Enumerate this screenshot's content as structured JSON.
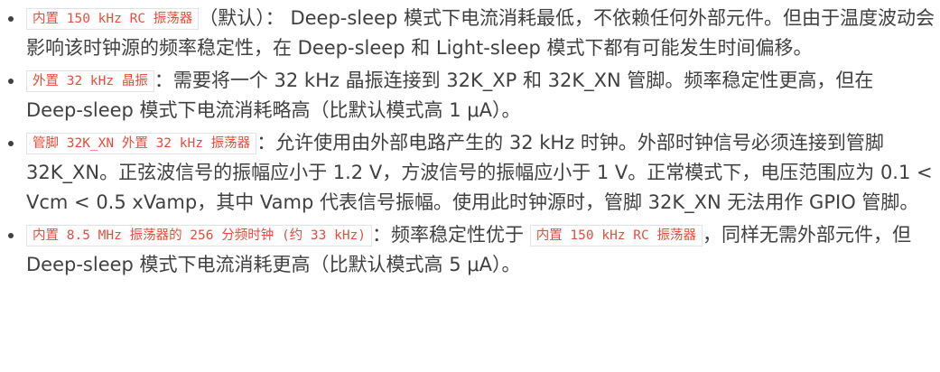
{
  "items": [
    {
      "code": "内置 150 kHz RC 振荡器",
      "text": "（默认）： Deep-sleep 模式下电流消耗最低，不依赖任何外部元件。但由于温度波动会影响该时钟源的频率稳定性，在 Deep-sleep 和 Light-sleep 模式下都有可能发生时间偏移。"
    },
    {
      "code": "外置 32 kHz 晶振",
      "text": "：需要将一个 32 kHz 晶振连接到 32K_XP 和 32K_XN 管脚。频率稳定性更高，但在 Deep-sleep 模式下电流消耗略高（比默认模式高 1 μA）。"
    },
    {
      "code": "管脚 32K_XN 外置 32 kHz 振荡器",
      "text": "：允许使用由外部电路产生的 32 kHz 时钟。外部时钟信号必须连接到管脚 32K_XN。正弦波信号的振幅应小于 1.2 V，方波信号的振幅应小于 1 V。正常模式下，电压范围应为 0.1 < Vcm < 0.5 xVamp，其中 Vamp 代表信号振幅。使用此时钟源时，管脚 32K_XN 无法用作 GPIO 管脚。"
    },
    {
      "code": "内置 8.5 MHz 振荡器的 256 分频时钟 (约 33 kHz)",
      "text_a": "：频率稳定性优于",
      "code2": "内置 150 kHz RC 振荡器",
      "text_b": "，同样无需外部元件，但 Deep-sleep 模式下电流消耗更高（比默认模式高 5 μA）。"
    }
  ]
}
